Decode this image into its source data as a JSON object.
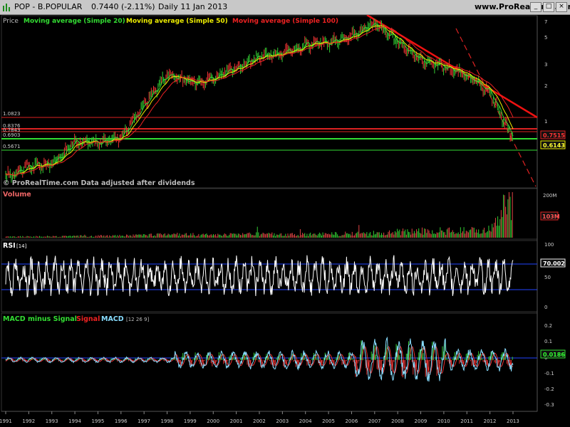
{
  "window": {
    "symbol": "POP - B.POPULAR",
    "price_change": "0.7440 (-2.11%)",
    "period_date": "Daily  11 Jan 2013",
    "site": "www.ProRealTime.com"
  },
  "price_panel": {
    "legend": [
      {
        "text": "Price",
        "color": "#ffffff"
      },
      {
        "text": "Moving average (Simple 20)",
        "color": "#33dd33"
      },
      {
        "text": "Moving average (Simple 50)",
        "color": "#eeee00"
      },
      {
        "text": "Moving average (Simple 100)",
        "color": "#ee2222"
      }
    ],
    "watermark": "© ProRealTime.com  Data adjusted after dividends",
    "left_levels": [
      "1.0823",
      "0.8376",
      "0.7843",
      "0.6903",
      "0.5671"
    ],
    "last_value": "0.7515",
    "ma_value": "0.6143"
  },
  "volume_panel": {
    "title": "Volume",
    "last_value": "103M"
  },
  "rsi_panel": {
    "title": "RSI",
    "params": "[14]",
    "last_value": "70.002"
  },
  "macd_panel": {
    "legend": [
      {
        "text": "MACD minus Signal",
        "color": "#33dd33"
      },
      {
        "text": "Signal",
        "color": "#ee2222"
      },
      {
        "text": "MACD",
        "color": "#88ddff"
      }
    ],
    "params": "[12 26 9]",
    "last_value": "0.0186"
  },
  "chart_data": [
    {
      "type": "line",
      "title": "POP - B.POPULAR Daily",
      "scale": "log",
      "y_ticks": [
        "7",
        "5",
        "3",
        "2",
        "1"
      ],
      "x": [
        1991,
        1992,
        1993,
        1994,
        1995,
        1996,
        1997,
        1998,
        1999,
        2000,
        2001,
        2002,
        2003,
        2004,
        2005,
        2006,
        2007,
        2008,
        2009,
        2010,
        2011,
        2012,
        2013
      ],
      "series": [
        {
          "name": "Price",
          "values": [
            0.36,
            0.44,
            0.46,
            0.71,
            0.69,
            0.78,
            1.45,
            2.6,
            2.2,
            2.4,
            2.9,
            3.6,
            3.8,
            4.6,
            4.7,
            5.4,
            6.8,
            4.8,
            3.4,
            3.0,
            2.5,
            1.8,
            0.74
          ]
        }
      ],
      "horizontal_levels": [
        1.0823,
        0.8376,
        0.7843,
        0.6903,
        0.5671
      ],
      "ylim": [
        0.3,
        7.5
      ]
    },
    {
      "type": "bar",
      "title": "Volume",
      "y_ticks": [
        "200M"
      ],
      "x": [
        1991,
        1992,
        1993,
        1994,
        1995,
        1996,
        1997,
        1998,
        1999,
        2000,
        2001,
        2002,
        2003,
        2004,
        2005,
        2006,
        2007,
        2008,
        2009,
        2010,
        2011,
        2012,
        2013
      ],
      "values": [
        4,
        6,
        6,
        7,
        8,
        9,
        12,
        18,
        14,
        12,
        14,
        16,
        15,
        15,
        16,
        18,
        20,
        26,
        30,
        30,
        32,
        36,
        200
      ],
      "ylim": [
        0,
        210
      ]
    },
    {
      "type": "line",
      "title": "RSI",
      "y_ticks": [
        "100",
        "50",
        "0"
      ],
      "reference_lines": [
        70,
        30
      ],
      "ylim": [
        0,
        100
      ]
    },
    {
      "type": "line",
      "title": "MACD",
      "y_ticks": [
        "0.2",
        "0.1",
        "0",
        "-0.1",
        "-0.2",
        "-0.3"
      ],
      "ylim": [
        -0.33,
        0.25
      ]
    }
  ]
}
